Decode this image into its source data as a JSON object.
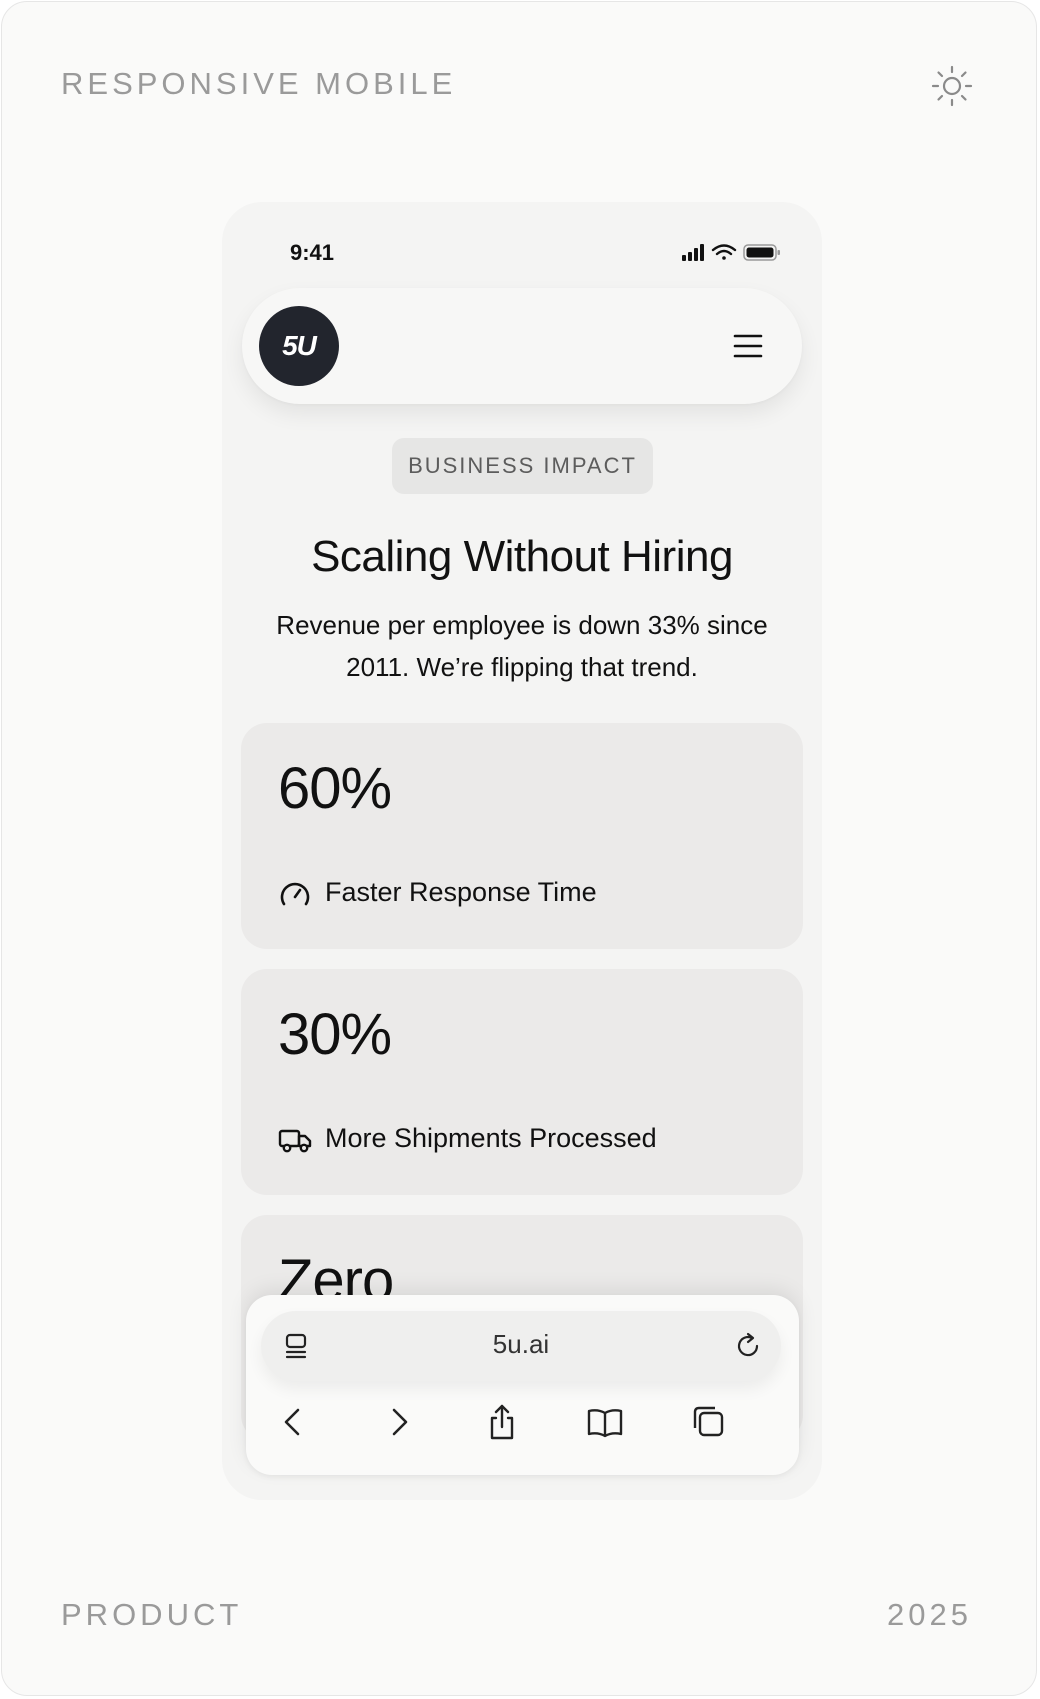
{
  "corners": {
    "top_left": "RESPONSIVE MOBILE",
    "bottom_left": "PRODUCT",
    "bottom_right": "2025",
    "theme_icon": "sun-icon"
  },
  "status_bar": {
    "time": "9:41",
    "icons": [
      "signal-icon",
      "wifi-icon",
      "battery-icon"
    ]
  },
  "nav": {
    "logo_text": "5U",
    "menu_icon": "hamburger-menu-icon"
  },
  "section": {
    "badge": "BUSINESS IMPACT",
    "title": "Scaling Without Hiring",
    "subtitle_line1": "Revenue per employee is down 33% since",
    "subtitle_line2": "2011. We’re flipping that trend."
  },
  "stats": [
    {
      "value": "60%",
      "label": "Faster Response Time",
      "icon": "gauge-icon"
    },
    {
      "value": "30%",
      "label": "More Shipments Processed",
      "icon": "truck-icon"
    },
    {
      "value": "Zero",
      "label": "",
      "icon": ""
    }
  ],
  "browser": {
    "url": "5u.ai",
    "left_icon": "page-menu-icon",
    "right_icon": "reload-icon",
    "toolbar": [
      "back-icon",
      "forward-icon",
      "share-icon",
      "bookmarks-icon",
      "tabs-icon"
    ]
  },
  "colors": {
    "logo_bg": "#22252d",
    "card_bg": "#ebeae9",
    "badge_bg": "#e6e6e5",
    "accent_text": "#111111",
    "muted_text": "#9a9a9a"
  }
}
